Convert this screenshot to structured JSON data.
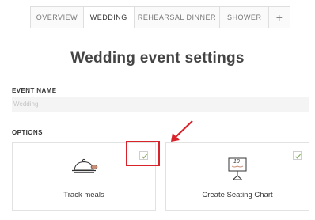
{
  "tabs": [
    {
      "label": "OVERVIEW",
      "active": false
    },
    {
      "label": "WEDDING",
      "active": true
    },
    {
      "label": "REHEARSAL DINNER",
      "active": false
    },
    {
      "label": "SHOWER",
      "active": false
    },
    {
      "label": "+",
      "active": false
    }
  ],
  "page_title": "Wedding event settings",
  "event_name": {
    "label": "EVENT NAME",
    "value": "",
    "placeholder": "Wedding"
  },
  "options": {
    "label": "OPTIONS",
    "cards": [
      {
        "label": "Track meals",
        "icon": "cloche-icon",
        "checked": true
      },
      {
        "label": "Create Seating Chart",
        "icon": "table-card-icon",
        "checked": true,
        "icon_text": "10"
      }
    ]
  },
  "colors": {
    "annotation": "#d8232a",
    "check": "#8db36a",
    "border": "#e2e2e2"
  }
}
